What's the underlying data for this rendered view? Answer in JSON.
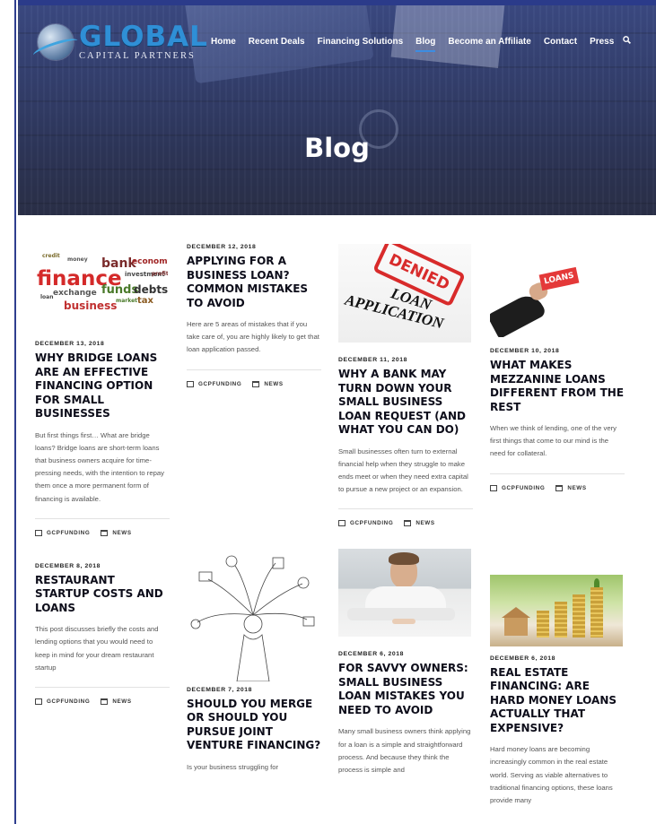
{
  "brand": {
    "title": "GLOBAL",
    "subtitle": "CAPITAL PARTNERS"
  },
  "nav": {
    "items": [
      {
        "label": "Home"
      },
      {
        "label": "Recent Deals"
      },
      {
        "label": "Financing Solutions"
      },
      {
        "label": "Blog"
      },
      {
        "label": "Become an Affiliate"
      },
      {
        "label": "Contact"
      },
      {
        "label": "Press"
      }
    ],
    "active": "Blog",
    "search_icon": "search-icon"
  },
  "hero": {
    "title": "Blog"
  },
  "posts": [
    {
      "date": "DECEMBER 13, 2018",
      "title": "WHY BRIDGE LOANS ARE AN EFFECTIVE FINANCING OPTION FOR SMALL BUSINESSES",
      "excerpt": "But first things first… What are bridge loans? Bridge loans are short-term loans that business owners acquire for time-pressing needs, with the intention to repay them once a more permanent form of financing is available.",
      "author": "GCPFUNDING",
      "category": "NEWS"
    },
    {
      "date": "DECEMBER 12, 2018",
      "title": "APPLYING FOR A BUSINESS LOAN? COMMON MISTAKES TO AVOID",
      "excerpt": "Here are 5 areas of mistakes that if you take care of, you are highly likely to get that loan application passed.",
      "author": "GCPFUNDING",
      "category": "NEWS"
    },
    {
      "date": "DECEMBER 11, 2018",
      "title": "WHY A BANK MAY TURN DOWN YOUR SMALL BUSINESS LOAN REQUEST (AND WHAT YOU CAN DO)",
      "excerpt": "Small businesses often turn to external financial help when they struggle to make ends meet or when they need extra capital to pursue a new project or an expansion.",
      "author": "GCPFUNDING",
      "category": "NEWS",
      "image_text": {
        "stamp": "DENIED",
        "line1": "LOAN",
        "line2": "APPLICATION"
      }
    },
    {
      "date": "DECEMBER 10, 2018",
      "title": "WHAT MAKES MEZZANINE LOANS DIFFERENT FROM THE REST",
      "excerpt": "When we think of lending, one of the very first things that come to our mind is the need for collateral.",
      "author": "GCPFUNDING",
      "category": "NEWS",
      "image_text": {
        "sign": "LOANS"
      }
    },
    {
      "date": "DECEMBER 8, 2018",
      "title": "RESTAURANT STARTUP COSTS AND LOANS",
      "excerpt": "This post discusses briefly the costs and lending options that you would need to keep in mind for your dream restaurant startup",
      "author": "GCPFUNDING",
      "category": "NEWS"
    },
    {
      "date": "DECEMBER 7, 2018",
      "title": "SHOULD YOU MERGE OR SHOULD YOU PURSUE JOINT VENTURE FINANCING?",
      "excerpt": "Is your business struggling for",
      "author": "GCPFUNDING",
      "category": "NEWS"
    },
    {
      "date": "DECEMBER 6, 2018",
      "title": "FOR SAVVY OWNERS: SMALL BUSINESS LOAN MISTAKES YOU NEED TO AVOID",
      "excerpt": "Many small business owners think applying for a loan is a simple and straightforward process. And because they think the process is simple and",
      "author": "GCPFUNDING",
      "category": "NEWS"
    },
    {
      "date": "DECEMBER 6, 2018",
      "title": "REAL ESTATE FINANCING: ARE HARD MONEY LOANS ACTUALLY THAT EXPENSIVE?",
      "excerpt": "Hard money loans are becoming increasingly common in the real estate world. Serving as viable alternatives to traditional financing options, these loans provide many",
      "author": "GCPFUNDING",
      "category": "NEWS"
    }
  ],
  "cloud_words": [
    "finance",
    "bank",
    "economy",
    "investment",
    "exchange",
    "funds",
    "debts",
    "tax",
    "business",
    "credit",
    "money",
    "loan",
    "market",
    "profit"
  ]
}
